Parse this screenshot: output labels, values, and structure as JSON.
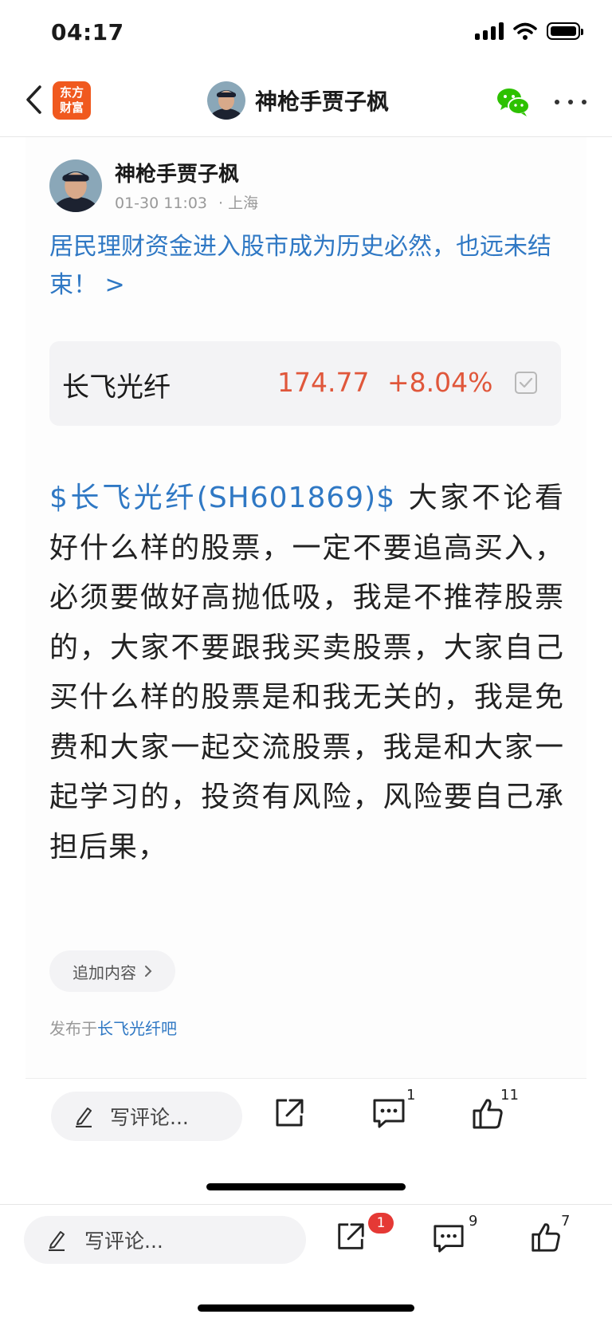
{
  "status_bar": {
    "time": "04:17",
    "battery_level": 1.0
  },
  "nav": {
    "app_logo_line1": "东方",
    "app_logo_line2": "财富",
    "title": "神枪手贾子枫"
  },
  "post": {
    "author": "神枪手贾子枫",
    "date": "01-30 11:03",
    "location": "· 上海",
    "article_link": "居民理财资金进入股市成为历史必然，也远未结束！ >",
    "stock": {
      "name": "长飞光纤",
      "price": "174.77",
      "change": "+8.04%"
    },
    "stock_tag": "$长飞光纤(SH601869)$",
    "body": "大家不论看好什么样的股票，一定不要追高买入，必须要做好高抛低吸，我是不推荐股票的，大家不要跟我买卖股票，大家自己买什么样的股票是和我无关的，我是免费和大家一起交流股票，我是和大家一起学习的，投资有风险，风险要自己承担后果，",
    "append_label": "追加内容",
    "forum_prefix": "发布于",
    "forum_name": "长飞光纤吧"
  },
  "inner_bar": {
    "comment_placeholder": "写评论...",
    "comment_count": "1",
    "like_count": "11"
  },
  "outer_bar": {
    "comment_placeholder": "写评论...",
    "share_badge": "1",
    "comment_count": "9",
    "like_count": "7"
  },
  "colors": {
    "link_blue": "#2f78c4",
    "price_red": "#e0573b",
    "brand_orange": "#f0591f",
    "badge_red": "#e53935",
    "wechat_green": "#2dc100"
  },
  "icons": [
    "back-arrow-icon",
    "wechat-icon",
    "more-icon",
    "check-icon",
    "chevron-right-icon",
    "pencil-icon",
    "share-icon",
    "comment-icon",
    "like-icon"
  ]
}
